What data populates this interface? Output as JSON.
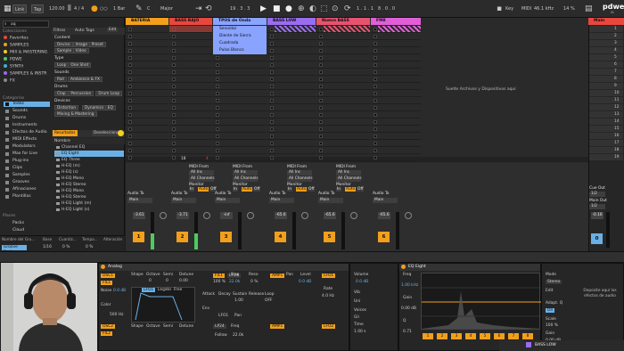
{
  "colors": {
    "accent": "#f29f1c",
    "selection": "#6ab0e6",
    "bateria": "#f29f1c",
    "bass_bajo": "#e8473e",
    "tipos_onda": "#8aa3ff",
    "bass_low": "#9a6cf0",
    "nuevo": "#e5536f",
    "fm": "#e05fd6",
    "master": "#e8473e"
  },
  "topbar": {
    "link": "Link",
    "tap": "Tap",
    "tempo": "120.00",
    "signature": "4 / 4",
    "quantize": "1 Bar",
    "scale_root": "C",
    "scale": "Major",
    "position": "19 . 3 . 3",
    "loop_start": "1 . 1 . 1",
    "loop_len": "8 . 0 . 0",
    "key_label": "Key",
    "midi_label": "MIDI",
    "sample_rate": "46.1 kHz",
    "cpu": "14 %",
    "brand": "pdwe",
    "brand_sub": "IN"
  },
  "browser": {
    "search_placeholder": "aq",
    "collections_header": "Colecciones",
    "collections": [
      {
        "label": "Favoritos",
        "color": "#e8473e"
      },
      {
        "label": "SAMPLES",
        "color": "#f29f1c"
      },
      {
        "label": "MIX & MASTERING",
        "color": "#f2d21c"
      },
      {
        "label": "PDWE",
        "color": "#4ccd5b"
      },
      {
        "label": "SYNTH",
        "color": "#3db3d6"
      },
      {
        "label": "SAMPLES & INSTR",
        "color": "#9a6cf0"
      },
      {
        "label": "FX",
        "color": "#888888"
      }
    ],
    "categories_header": "Categorías",
    "categories": [
      "Todos",
      "Sounds",
      "Drums",
      "Instruments",
      "Efectos de Audio",
      "MIDI Effects",
      "Modulators",
      "Max for Live",
      "Plug-ins",
      "Clips",
      "Samples",
      "Grooves",
      "Afinaciones",
      "Plantillas"
    ],
    "places_header": "Places",
    "places": [
      "Packs",
      "Cloud"
    ],
    "filters_label": "Filtros",
    "auto_tags": "Auto Tags",
    "edit_label": "Edit",
    "filter_groups": [
      {
        "title": "Content",
        "chips": [
          "Device",
          "Image",
          "Preset",
          "Sample",
          "Video"
        ]
      },
      {
        "title": "Type",
        "chips": [
          "Loop",
          "One Shot"
        ]
      },
      {
        "title": "Sounds",
        "chips": [
          "Pad",
          "Ambience & FX"
        ]
      },
      {
        "title": "Drums",
        "chips": [
          "Clap",
          "Percussion",
          "Drum Loop"
        ]
      },
      {
        "title": "Devices",
        "chips": [
          "Distortion",
          "Dynamics",
          "EQ",
          "Mixing & Mastering"
        ]
      }
    ],
    "results_label": "Resultados",
    "deselect_label": "Deseleccionar",
    "name_header": "Nombre",
    "files": [
      "Channel EQ",
      "EQ Eight",
      "EQ Three",
      "H-EQ (m)",
      "H-EQ (s)",
      "H-EQ Mono",
      "H-EQ Stereo",
      "H-EQ Mono",
      "H-EQ Stereo",
      "H-EQ Light (m)",
      "H-EQ Light (s)"
    ],
    "status": "1 item selected",
    "table_headers": [
      "Nombre del Gru...",
      "Base",
      "Cuantiz...",
      "Tempo...",
      "Alteración"
    ],
    "table_row": {
      "name": "Groove Pool",
      "base": "1/16",
      "quant": "0 %",
      "tempo": "0 %"
    },
    "global_amount": "Cantidad Global",
    "global_value": "100 %"
  },
  "tracks": [
    {
      "name": "BATERIA",
      "color": "#f29f1c",
      "clips": []
    },
    {
      "name": "BASS BAJO",
      "color": "#e8473e",
      "clips": []
    },
    {
      "name": "TPOS de Onda",
      "color": "#8aa3ff",
      "clips": [
        "Senoidal",
        "Diente de Sierra",
        "Cuadrada",
        "Pulso Blanco"
      ]
    },
    {
      "name": "BASS LOW",
      "color": "#9a6cf0",
      "clips": []
    },
    {
      "name": "Nuevo BASS",
      "color": "#e5536f",
      "clips": []
    },
    {
      "name": "FM8",
      "color": "#e05fd6",
      "clips": []
    }
  ],
  "drop_hint": "Suelte Archivos y Dispositivos aquí",
  "master": {
    "name": "Main",
    "scenes": [
      "1",
      "2",
      "3",
      "4",
      "5",
      "6",
      "7",
      "8",
      "9",
      "10",
      "11",
      "12",
      "13",
      "14",
      "15",
      "16",
      "17",
      "18",
      "19"
    ],
    "cue_out": "Cue Out",
    "cue_val": "1/2",
    "main_out": "Main Out",
    "main_val": "1/2",
    "vol": "-0.16",
    "num": "0"
  },
  "mixer": {
    "midi_from": "MIDI From",
    "all_ins": "All Ins",
    "all_channels": "All Channels",
    "monitor": "Monitor",
    "in": "In",
    "auto": "Auto",
    "off": "Off",
    "audio_to": "Audio To",
    "main": "Main",
    "strips": [
      {
        "vol": "-3.61",
        "num": "1"
      },
      {
        "vol": "-3.71",
        "num": "2"
      },
      {
        "vol": "-inf",
        "num": "3"
      },
      {
        "vol": "-65.6",
        "num": "4"
      },
      {
        "vol": "-65.6",
        "num": "5"
      },
      {
        "vol": "-65.6",
        "num": "6"
      }
    ]
  },
  "analog": {
    "title": "Analog",
    "osc1": "OSC1",
    "osc2": "OSC2",
    "noise": "Noise",
    "noise_val": "0.0 dB",
    "color": "Color",
    "color_val": "500 Hz",
    "shape": "Shape",
    "octave": "Octave",
    "semi": "Semi",
    "detune": "Detune",
    "fil1": "FIL1",
    "fil2": "FIL2",
    "freq": "Freq",
    "reso": "Reso",
    "amp1": "AMP1",
    "level": "Level",
    "pan": "Pan",
    "lfo1": "LFO1",
    "lfo2": "LFO2",
    "rate": "Rate",
    "volume": "Volume",
    "vol_val": "0.0 dB",
    "env": "Env",
    "legato": "Legato",
    "free": "Free",
    "attack": "Attack",
    "decay": "Decay",
    "sustain": "Sustain",
    "release": "Release",
    "loop": "Loop",
    "lp24": "LP24",
    "follow": "Follow",
    "sync": "Sync",
    "voices": "Voices",
    "vib": "Vib",
    "unison": "Uni",
    "gli": "Gli",
    "time": "Time",
    "octave_val": "0",
    "semi_val": "0",
    "detune_val": "0.00",
    "freq_val": "22.0k",
    "reso_val": "0 %",
    "level_val": "0.0 dB",
    "rate_val": "4.0 Hz",
    "time_val": "1.00 s",
    "sustain_val": "1.00",
    "loop_val": "OFF",
    "tone": "100 %"
  },
  "eq": {
    "title": "EQ Eight",
    "freq": "Freq",
    "gain": "Gain",
    "q": "Q",
    "mode": "Mode",
    "mode_val": "Stereo",
    "edit": "Edit",
    "adapt": "Adapt. Q",
    "on": "On",
    "scale": "Scale",
    "scale_val": "100 %",
    "gain_out": "Gain",
    "gain_out_val": "0.00 dB",
    "freq_val": "1.00 kHz",
    "gain_val": "0.00 dB",
    "q_val": "0.71",
    "bands": [
      "1",
      "2",
      "3",
      "4",
      "5",
      "6",
      "7",
      "8"
    ]
  },
  "drop_fx": "Deposite aquí los efectos de audio",
  "footer_track": "BASS LOW"
}
